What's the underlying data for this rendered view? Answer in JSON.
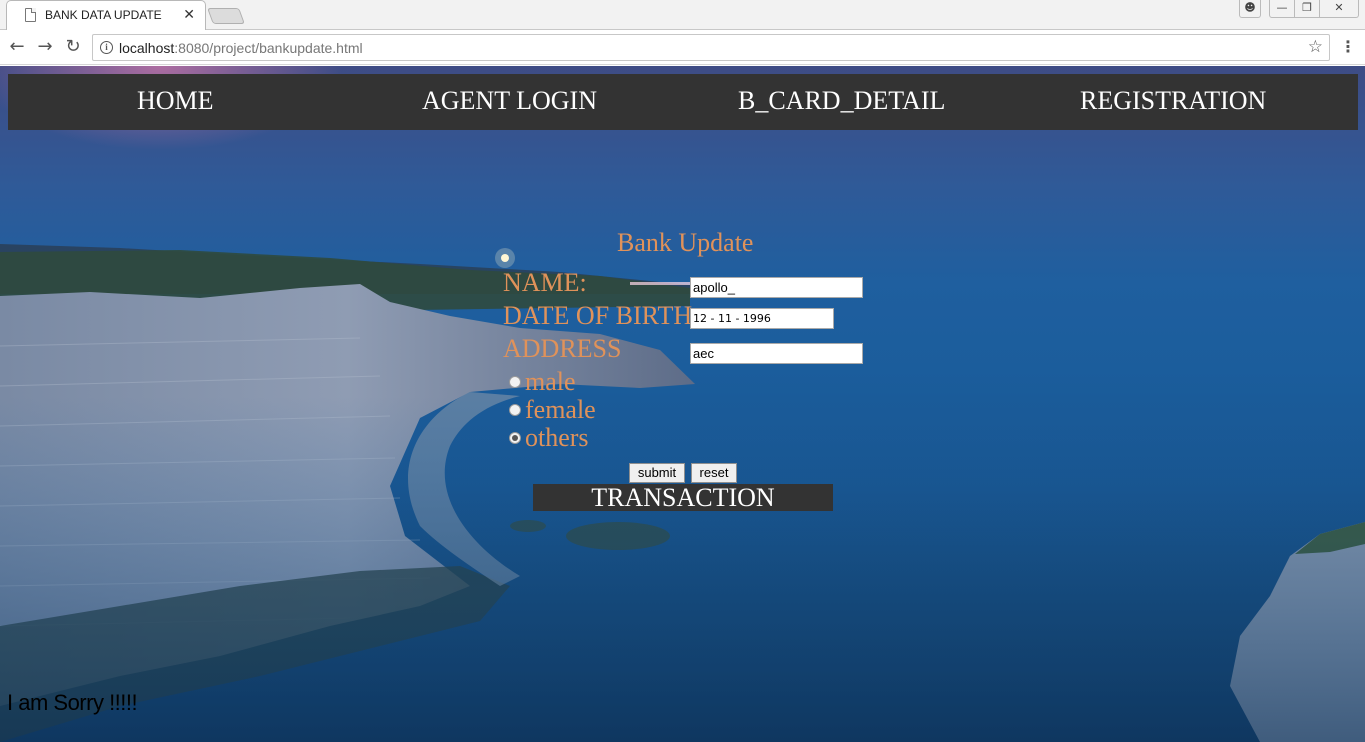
{
  "browser": {
    "tab_title": "BANK DATA UPDATE",
    "tab_close": "✕",
    "url_host": "localhost",
    "url_rest": ":8080/project/bankupdate.html"
  },
  "nav": {
    "home": "HOME",
    "agent_login": "AGENT LOGIN",
    "b_card_detail": "B_CARD_DETAIL",
    "registration": "REGISTRATION"
  },
  "form": {
    "title": "Bank Update",
    "name_label": "NAME:",
    "name_value": "apollo_",
    "dob_label": "DATE OF BIRTH",
    "dob_value": "12 - 11 - 1996",
    "address_label": "ADDRESS",
    "address_value": "aec",
    "gender_options": [
      "male",
      "female",
      "others"
    ],
    "gender_selected": "others",
    "submit_label": "submit",
    "reset_label": "reset"
  },
  "transaction_label": "TRANSACTION",
  "footer_text": "I am Sorry !!!!!",
  "colors": {
    "nav_bg": "#333333",
    "label": "#e0925a"
  }
}
